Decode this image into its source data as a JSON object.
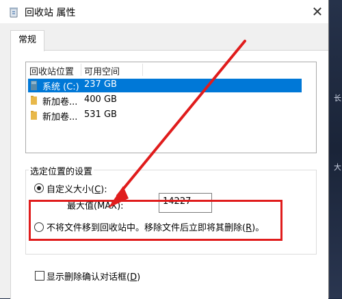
{
  "window": {
    "title": "回收站 属性",
    "close_glyph": "✕"
  },
  "tabs": [
    {
      "label": "常规"
    }
  ],
  "list": {
    "columns": [
      "回收站位置",
      "可用空间"
    ],
    "rows": [
      {
        "name": "系统 (C:)",
        "space": "237 GB",
        "icon": "drive-icon",
        "selected": true
      },
      {
        "name": "新加卷...",
        "space": "400 GB",
        "icon": "folder-icon",
        "selected": false
      },
      {
        "name": "新加卷...",
        "space": "531 GB",
        "icon": "folder-icon",
        "selected": false
      }
    ]
  },
  "settings": {
    "group_title": "选定位置的设置",
    "custom_size": {
      "label_prefix": "自定义大小(",
      "accel": "C",
      "label_suffix": "):",
      "checked": true
    },
    "max_size": {
      "label": "最大值(MAX):",
      "value": "14227"
    },
    "no_recycle": {
      "label_prefix": "不将文件移到回收站中。移除文件后立即将其删除(",
      "accel": "R",
      "label_suffix": ")。",
      "checked": false
    },
    "confirm_delete": {
      "label_prefix": "显示删除确认对话框(",
      "accel": "D",
      "label_suffix": ")",
      "checked": false
    }
  },
  "background": {
    "text_1": "长",
    "text_2": "大"
  },
  "annotation": {
    "color": "#e01c1c"
  },
  "colors": {
    "selection": "#0078d7",
    "folder": "#e8b84a",
    "drive": "#5a8aa8"
  }
}
